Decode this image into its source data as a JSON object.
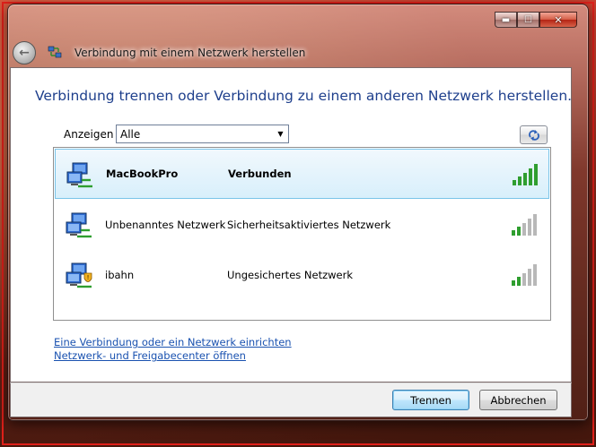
{
  "window": {
    "title": "Verbindung mit einem Netzwerk herstellen",
    "caption": {
      "minimize": "▬",
      "maximize": "☐",
      "close": "✕"
    }
  },
  "heading": "Verbindung trennen oder Verbindung zu einem anderen Netzwerk herstellen.",
  "filter": {
    "label": "Anzeigen",
    "value": "Alle"
  },
  "networks": [
    {
      "name": "MacBookPro",
      "status": "Verbunden",
      "signal_bars": 5,
      "selected": true,
      "icon": "network-icon"
    },
    {
      "name": "Unbenanntes Netzwerk",
      "status": "Sicherheitsaktiviertes Netzwerk",
      "signal_bars": 2,
      "selected": false,
      "icon": "network-icon"
    },
    {
      "name": "ibahn",
      "status": "Ungesichertes Netzwerk",
      "signal_bars": 2,
      "selected": false,
      "icon": "network-unsecured-icon"
    }
  ],
  "links": {
    "setup": "Eine Verbindung oder ein Netzwerk einrichten",
    "center": "Netzwerk- und Freigabecenter öffnen"
  },
  "buttons": {
    "disconnect": "Trennen",
    "cancel": "Abbrechen"
  },
  "colors": {
    "heading": "#1e3f8c",
    "link": "#1a52b0",
    "signal_on": "#2f9e2f",
    "signal_off": "#b8b8b8",
    "selection": "#d8effb"
  }
}
